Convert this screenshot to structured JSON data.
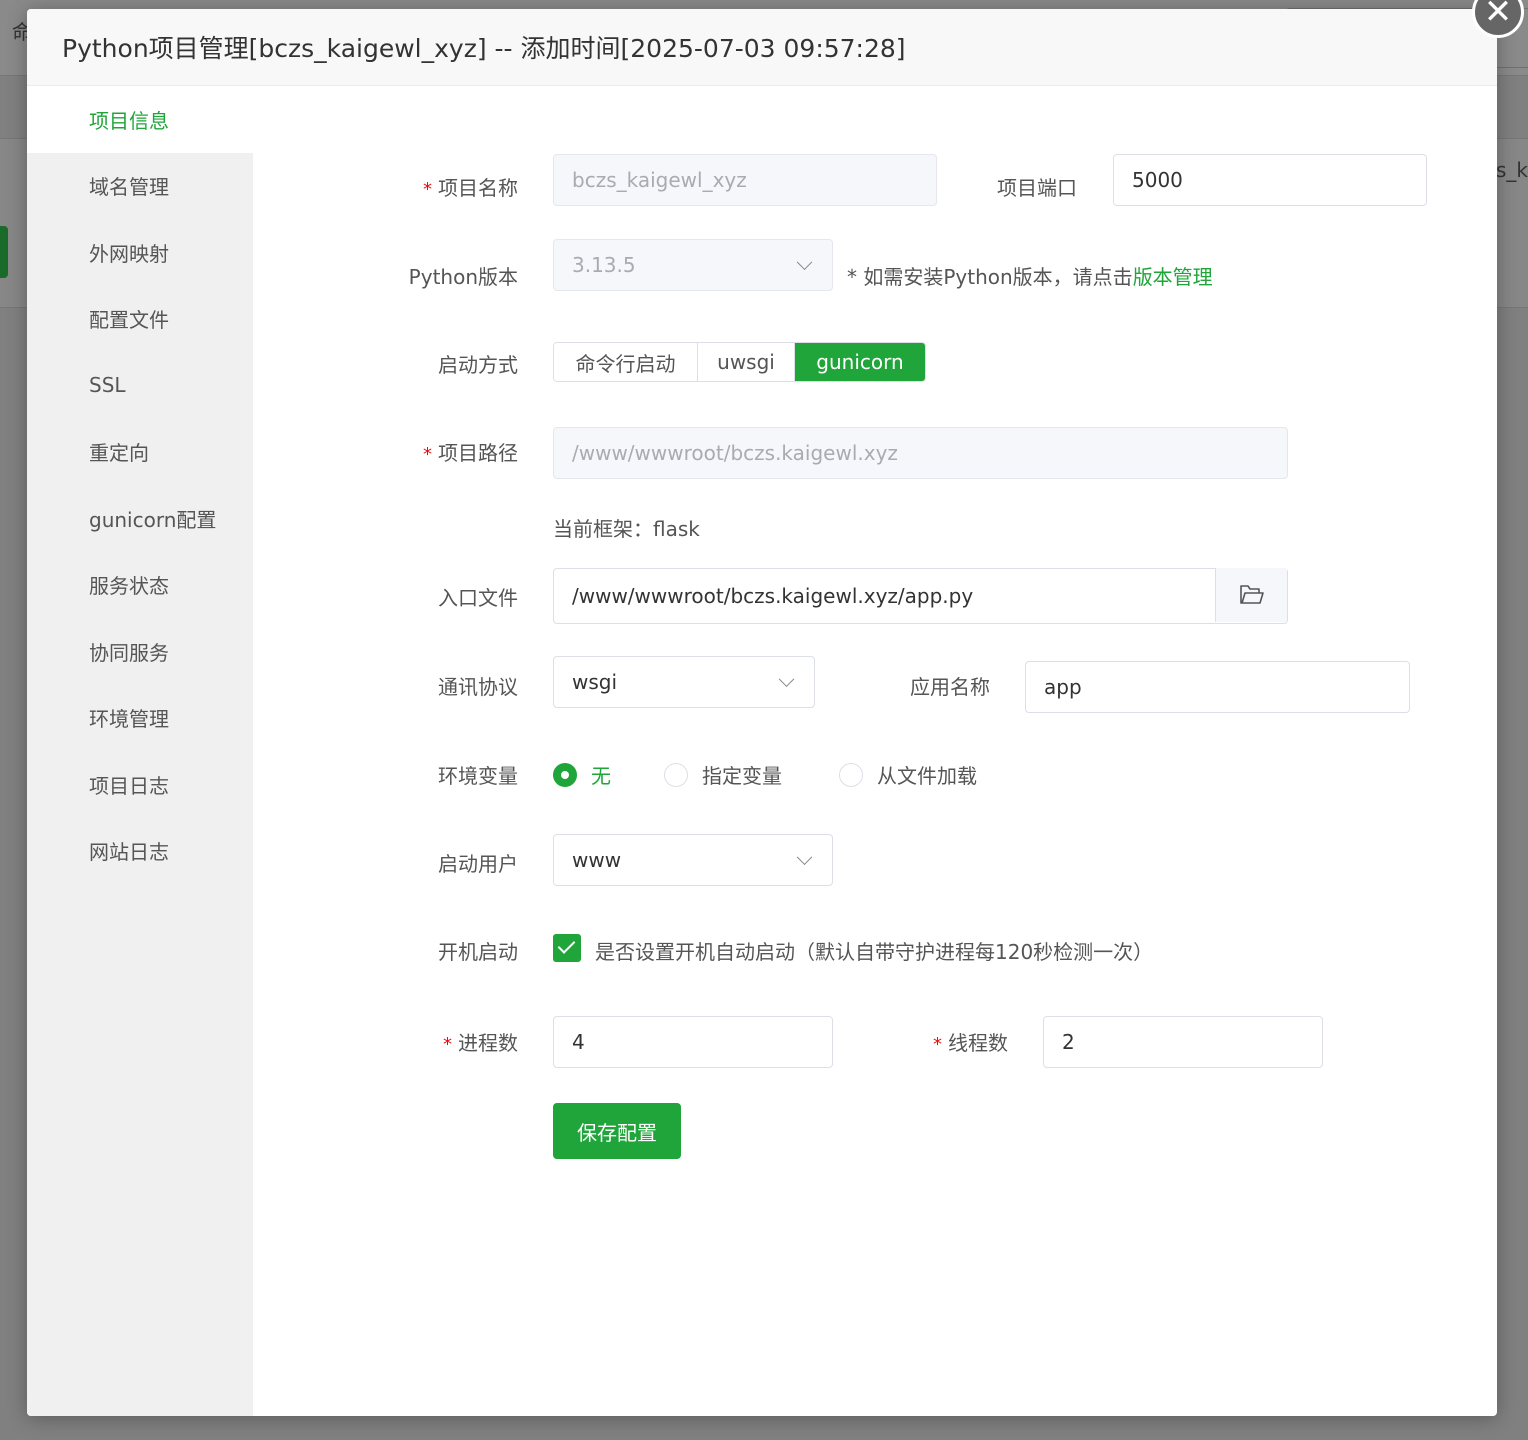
{
  "background": {
    "left_text": "命",
    "right_text": "s_k"
  },
  "modal": {
    "title": "Python项目管理[bczs_kaigewl_xyz] -- 添加时间[2025-07-03 09:57:28]",
    "close_glyph": "✕"
  },
  "sidebar": {
    "items": [
      {
        "label": "项目信息",
        "active": true
      },
      {
        "label": "域名管理"
      },
      {
        "label": "外网映射"
      },
      {
        "label": "配置文件"
      },
      {
        "label": "SSL"
      },
      {
        "label": "重定向"
      },
      {
        "label": "gunicorn配置"
      },
      {
        "label": "服务状态"
      },
      {
        "label": "协同服务"
      },
      {
        "label": "环境管理"
      },
      {
        "label": "项目日志"
      },
      {
        "label": "网站日志"
      }
    ]
  },
  "form": {
    "required_mark": "*",
    "project_name": {
      "label": "项目名称",
      "value": "bczs_kaigewl_xyz"
    },
    "project_port": {
      "label": "项目端口",
      "value": "5000"
    },
    "python_version": {
      "label": "Python版本",
      "value": "3.13.5",
      "note": "* 如需安装Python版本，请点击",
      "note_link": "版本管理"
    },
    "start_mode": {
      "label": "启动方式",
      "options": [
        "命令行启动",
        "uwsgi",
        "gunicorn"
      ],
      "selected": "gunicorn"
    },
    "project_path": {
      "label": "项目路径",
      "value": "/www/wwwroot/bczs.kaigewl.xyz"
    },
    "framework": {
      "text": "当前框架：flask"
    },
    "entry_file": {
      "label": "入口文件",
      "value": "/www/wwwroot/bczs.kaigewl.xyz/app.py",
      "button_icon": "folder-open-icon"
    },
    "protocol": {
      "label": "通讯协议",
      "value": "wsgi"
    },
    "app_name": {
      "label": "应用名称",
      "value": "app"
    },
    "env_vars": {
      "label": "环境变量",
      "options": [
        "无",
        "指定变量",
        "从文件加载"
      ],
      "selected": "无"
    },
    "run_user": {
      "label": "启动用户",
      "value": "www"
    },
    "autostart": {
      "label": "开机启动",
      "checked": true,
      "text": "是否设置开机自动启动（默认自带守护进程每120秒检测一次）"
    },
    "processes": {
      "label": "进程数",
      "value": "4"
    },
    "threads": {
      "label": "线程数",
      "value": "2"
    },
    "save_label": "保存配置"
  },
  "colors": {
    "accent": "#20a53a",
    "required": "#ef0808",
    "sidebar_bg": "#f0f0f0"
  }
}
